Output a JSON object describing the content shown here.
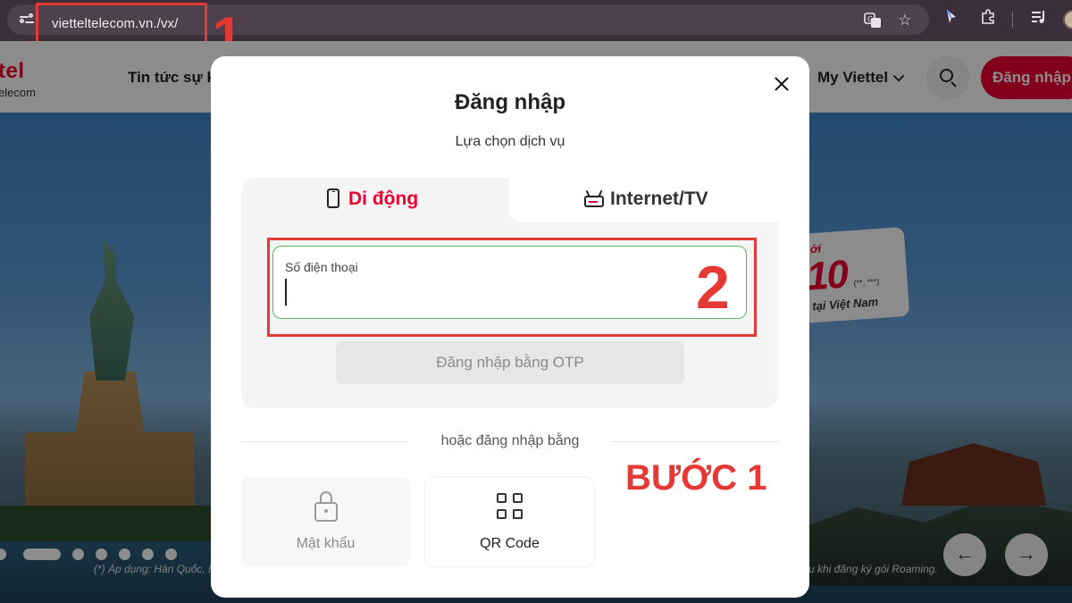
{
  "browser": {
    "url": "vietteltelecom.vn./vx/",
    "icons": [
      "site-info-icon",
      "translate-icon",
      "star-icon",
      "cursor-extension-icon",
      "puzzle-icon",
      "media-queue-icon",
      "profile-avatar"
    ]
  },
  "site": {
    "logo_main": "tel",
    "logo_sub": "elecom",
    "nav_news": "Tin tức sự k",
    "nav_myviettel": "My Viettel",
    "login_button": "Đăng nhập",
    "brand_color": "#ee0033"
  },
  "hero": {
    "promo_small": "ới",
    "promo_big": "10",
    "promo_stars": "(**, ***)",
    "promo_line": "tại Việt Nam",
    "footnote_left": "(*) Áp dụng: Hàn Quốc, H",
    "footnote_right": "u khi đăng ký gói Roaming.",
    "slide_count": 7,
    "active_slide": 2
  },
  "modal": {
    "title": "Đăng nhập",
    "subtitle": "Lựa chọn dịch vụ",
    "tabs": [
      {
        "label": "Di động",
        "icon": "mobile-phone-icon",
        "active": true
      },
      {
        "label": "Internet/TV",
        "icon": "router-icon",
        "active": false
      }
    ],
    "phone_label": "Số điện thoại",
    "phone_value": "",
    "otp_button": "Đăng nhập bằng OTP",
    "divider_text": "hoặc đăng nhập bằng",
    "alt_methods": [
      {
        "label": "Mật khẩu",
        "icon": "lock-icon"
      },
      {
        "label": "QR Code",
        "icon": "qr-code-icon"
      }
    ]
  },
  "annotations": {
    "num1": "1",
    "num2": "2",
    "step": "BƯỚC 1",
    "color": "#e53935"
  }
}
